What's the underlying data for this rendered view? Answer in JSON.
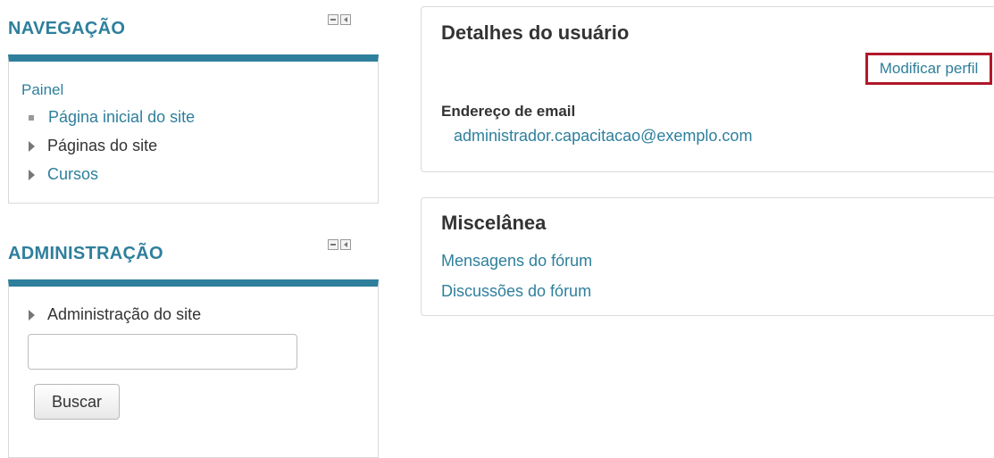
{
  "navigation": {
    "title": "NAVEGAÇÃO",
    "root": "Painel",
    "items": [
      {
        "label": "Página inicial do site",
        "type": "leaf",
        "link": true
      },
      {
        "label": "Páginas do site",
        "type": "branch",
        "link": false
      },
      {
        "label": "Cursos",
        "type": "branch",
        "link": true
      }
    ]
  },
  "administration": {
    "title": "ADMINISTRAÇÃO",
    "items": [
      {
        "label": "Administração do site",
        "type": "branch"
      }
    ],
    "search": {
      "value": "",
      "placeholder": ""
    },
    "search_button": "Buscar"
  },
  "user_details": {
    "title": "Detalhes do usuário",
    "edit_link": "Modificar perfil",
    "email_label": "Endereço de email",
    "email_value": "administrador.capacitacao@exemplo.com"
  },
  "misc": {
    "title": "Miscelânea",
    "links": [
      "Mensagens do fórum",
      "Discussões do fórum"
    ]
  },
  "colors": {
    "accent": "#2e7f9c",
    "highlight_border": "#b0182a"
  },
  "icons": [
    "minimize-block-icon",
    "dock-block-icon",
    "bullet-icon",
    "collapsed-triangle-icon"
  ]
}
